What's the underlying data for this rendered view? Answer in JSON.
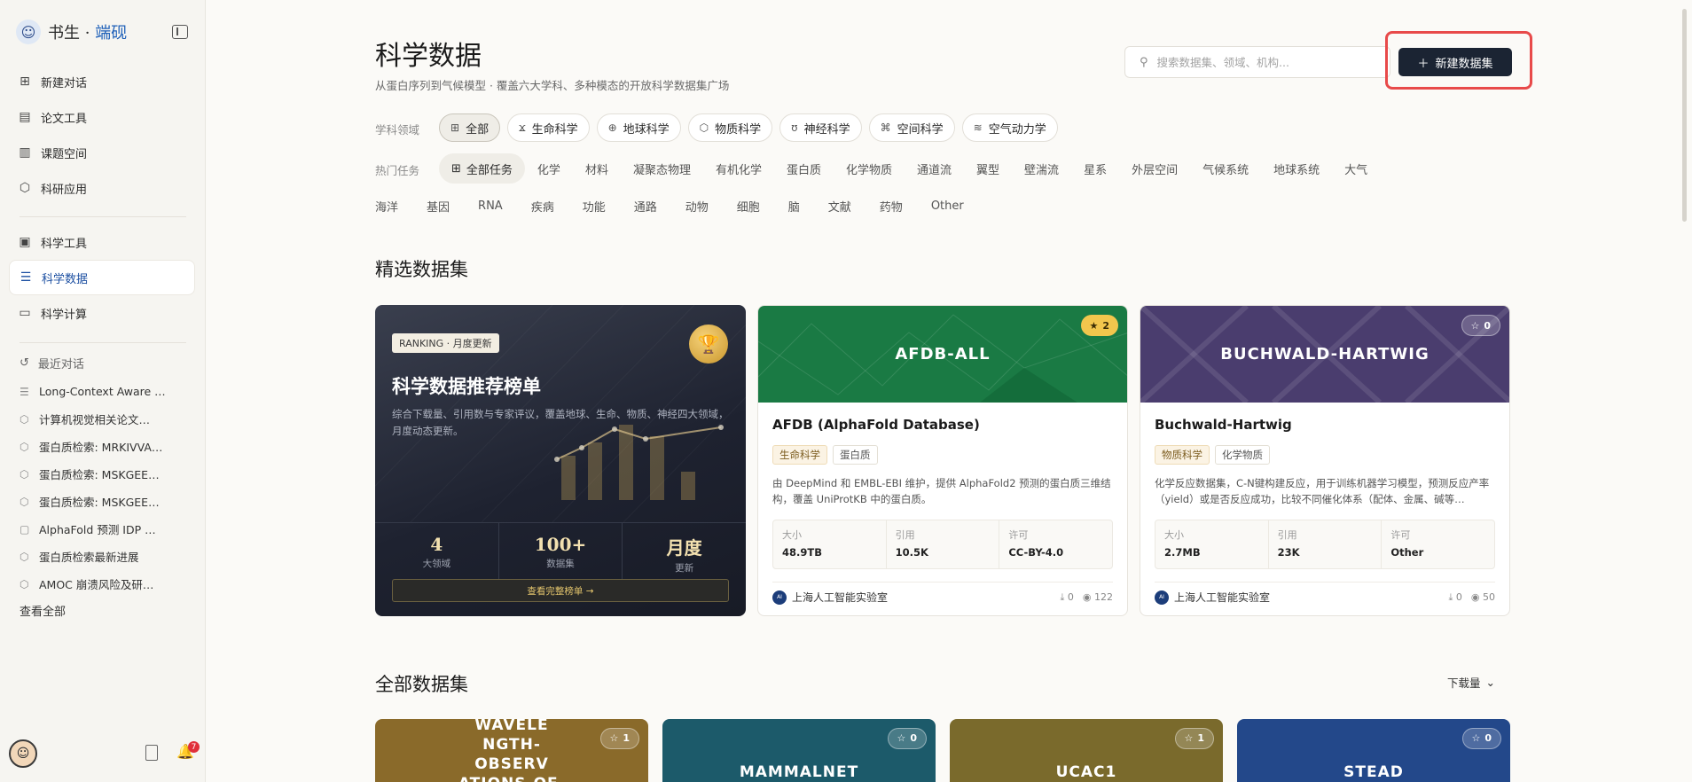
{
  "brand": {
    "name": "书生",
    "sep": " · ",
    "accent": "端砚"
  },
  "nav": {
    "top": [
      {
        "label": "新建对话",
        "icon": "plus-square-icon"
      },
      {
        "label": "论文工具",
        "icon": "document-icon"
      },
      {
        "label": "课题空间",
        "icon": "library-icon"
      },
      {
        "label": "科研应用",
        "icon": "cube-icon"
      }
    ],
    "tools": [
      {
        "label": "科学工具",
        "icon": "toolbox-icon"
      },
      {
        "label": "科学数据",
        "icon": "database-icon"
      },
      {
        "label": "科学计算",
        "icon": "monitor-icon"
      }
    ]
  },
  "recent": {
    "title": "最近对话",
    "items": [
      "Long-Context Aware …",
      "计算机视觉相关论文…",
      "蛋白质检索: MRKIVVA…",
      "蛋白质检索: MSKGEE…",
      "蛋白质检索: MSKGEE…",
      "AlphaFold 预测 IDP …",
      "蛋白质检索最新进展",
      "AMOC 崩溃风险及研…"
    ],
    "see_all": "查看全部"
  },
  "notifications": {
    "count": "7"
  },
  "header": {
    "title": "科学数据",
    "subtitle": "从蛋白序列到气候模型 · 覆盖六大学科、多种模态的开放科学数据集广场",
    "search_placeholder": "搜索数据集、领域、机构...",
    "new_button": "新建数据集"
  },
  "filters": {
    "domain_label": "学科领域",
    "domains": [
      "全部",
      "生命科学",
      "地球科学",
      "物质科学",
      "神经科学",
      "空间科学",
      "空气动力学"
    ],
    "task_label": "热门任务",
    "tasks_row1": [
      "全部任务",
      "化学",
      "材料",
      "凝聚态物理",
      "有机化学",
      "蛋白质",
      "化学物质",
      "通道流",
      "翼型",
      "壁湍流",
      "星系",
      "外层空间",
      "气候系统",
      "地球系统",
      "大气"
    ],
    "tasks_row2": [
      "海洋",
      "基因",
      "RNA",
      "疾病",
      "功能",
      "通路",
      "动物",
      "细胞",
      "脑",
      "文献",
      "药物",
      "Other"
    ]
  },
  "featured": {
    "title": "精选数据集",
    "ranking": {
      "tag": "RANKING · 月度更新",
      "title": "科学数据推荐榜单",
      "desc": "综合下载量、引用数与专家评议，覆盖地球、生命、物质、神经四大领域，月度动态更新。",
      "stats": [
        {
          "value": "4",
          "label": "大领域"
        },
        {
          "value": "100+",
          "label": "数据集"
        },
        {
          "value": "月度",
          "label": "更新"
        }
      ],
      "button": "查看完整榜单 →"
    },
    "cards": [
      {
        "banner": "AFDB-ALL",
        "stars": "2",
        "title": "AFDB (AlphaFold Database)",
        "tags": [
          "生命科学",
          "蛋白质"
        ],
        "desc": "由 DeepMind 和 EMBL-EBI 维护，提供 AlphaFold2 预测的蛋白质三维结构，覆盖 UniProtKB 中的蛋白质。",
        "meta": [
          {
            "label": "大小",
            "value": "48.9TB"
          },
          {
            "label": "引用",
            "value": "10.5K"
          },
          {
            "label": "许可",
            "value": "CC-BY-4.0"
          }
        ],
        "org": "上海人工智能实验室",
        "downloads": "0",
        "views": "122"
      },
      {
        "banner": "BUCHWALD-HARTWIG",
        "stars": "0",
        "title": "Buchwald-Hartwig",
        "tags": [
          "物质科学",
          "化学物质"
        ],
        "desc": "化学反应数据集，C-N键构建反应，用于训练机器学习模型，预测反应产率（yield）或是否反应成功，比较不同催化体系（配体、金属、碱等…",
        "meta": [
          {
            "label": "大小",
            "value": "2.7MB"
          },
          {
            "label": "引用",
            "value": "23K"
          },
          {
            "label": "许可",
            "value": "Other"
          }
        ],
        "org": "上海人工智能实验室",
        "downloads": "0",
        "views": "50"
      }
    ]
  },
  "all": {
    "title": "全部数据集",
    "sort": "下载量",
    "cards": [
      {
        "banner": "MULTI-WAVELE NGTH-OBSERV ATIONS-OF-SG",
        "stars": "1"
      },
      {
        "banner": "MAMMALNET",
        "stars": "0"
      },
      {
        "banner": "UCAC1",
        "stars": "1"
      },
      {
        "banner": "STEAD",
        "stars": "0"
      }
    ]
  },
  "colors": {
    "afdb_banner": "#1a7a44",
    "buchwald_banner": "#4a3d6e",
    "multi_banner": "#8a6a2a",
    "mammal_banner": "#1c5a6a",
    "ucac_banner": "#7a6a2c",
    "stead_banner": "#23488a",
    "highlight_frame": "#e84a4a"
  }
}
